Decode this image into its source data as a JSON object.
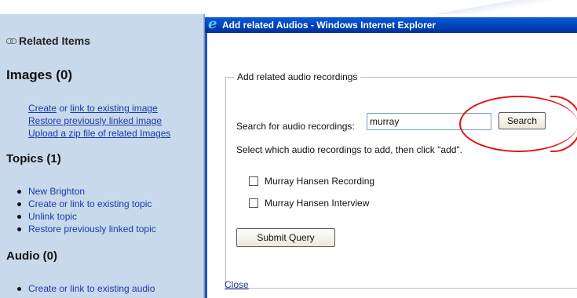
{
  "sidebar": {
    "related_header": "Related Items",
    "images": {
      "title": "Images (0)",
      "create": "Create",
      "or": "or",
      "link_existing": "link to existing image",
      "restore": "Restore previously linked image",
      "upload": "Upload a zip file of related Images"
    },
    "topics": {
      "title": "Topics (1)",
      "items": [
        "New Brighton",
        "Create or link to existing topic",
        "Unlink topic",
        "Restore previously linked topic"
      ]
    },
    "audio": {
      "title": "Audio (0)",
      "items": [
        "Create or link to existing audio"
      ]
    }
  },
  "popup": {
    "title": "Add related Audios - Windows Internet Explorer",
    "legend": "Add related audio recordings",
    "search_label": "Search for audio recordings:",
    "search_value": "murray",
    "search_button": "Search",
    "instructions": "Select which audio recordings to add, then click \"add\".",
    "results": [
      {
        "label": "Murray Hansen Recording",
        "checked": false
      },
      {
        "label": "Murray Hansen Interview",
        "checked": false
      }
    ],
    "submit_button": "Submit Query",
    "close_link": "Close"
  },
  "colors": {
    "sidebar_bg": "#c9d9ec",
    "titlebar": "#0040b8",
    "link": "#1a3aa8",
    "highlight_oval": "#e01010"
  }
}
